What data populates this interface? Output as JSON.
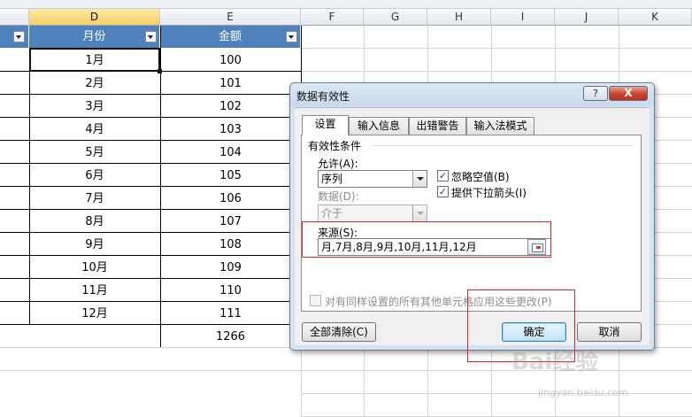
{
  "sheet": {
    "columns": [
      "D",
      "E",
      "F",
      "G",
      "H",
      "I",
      "J",
      "K"
    ],
    "headers": {
      "month": "月份",
      "amount": "金额"
    },
    "rows": [
      {
        "month": "1月",
        "amount": "100"
      },
      {
        "month": "2月",
        "amount": "101"
      },
      {
        "month": "3月",
        "amount": "102"
      },
      {
        "month": "4月",
        "amount": "103"
      },
      {
        "month": "5月",
        "amount": "104"
      },
      {
        "month": "6月",
        "amount": "105"
      },
      {
        "month": "7月",
        "amount": "106"
      },
      {
        "month": "8月",
        "amount": "107"
      },
      {
        "month": "9月",
        "amount": "108"
      },
      {
        "month": "10月",
        "amount": "109"
      },
      {
        "month": "11月",
        "amount": "110"
      },
      {
        "month": "12月",
        "amount": "111"
      }
    ],
    "total": "1266"
  },
  "dialog": {
    "title": "数据有效性",
    "help": "?",
    "close": "X",
    "tabs": [
      "设置",
      "输入信息",
      "出错警告",
      "输入法模式"
    ],
    "group_label": "有效性条件",
    "allow_label": "允许(A):",
    "allow_value": "序列",
    "ignore_blank": "忽略空值(B)",
    "dropdown_arrow": "提供下拉箭头(I)",
    "data_label": "数据(D):",
    "data_value": "介于",
    "source_label": "来源(S):",
    "source_value": "月,7月,8月,9月,10月,11月,12月",
    "apply_all": "对有同样设置的所有其他单元格应用这些更改(P)",
    "clear_all": "全部清除(C)",
    "ok": "确定",
    "cancel": "取消"
  },
  "watermark": {
    "brand": "Bai经验",
    "url": "jingyan.baidu.com"
  },
  "colors": {
    "header_blue": "#4f81bd",
    "highlight_red": "#e0242a",
    "selected_col": "#f5cd62"
  }
}
